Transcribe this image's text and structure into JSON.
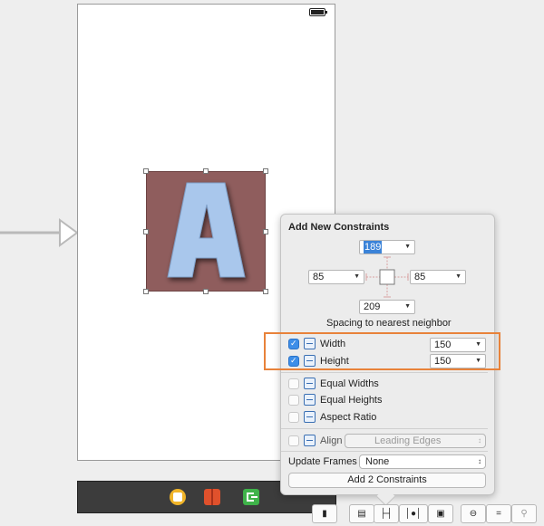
{
  "popover": {
    "title": "Add New Constraints",
    "top_spacing": "189",
    "left_spacing": "85",
    "right_spacing": "85",
    "bottom_spacing": "209",
    "spacing_caption": "Spacing to nearest neighbor",
    "width": {
      "label": "Width",
      "value": "150",
      "checked": true
    },
    "height": {
      "label": "Height",
      "value": "150",
      "checked": true
    },
    "equal_widths_label": "Equal Widths",
    "equal_heights_label": "Equal Heights",
    "aspect_ratio_label": "Aspect Ratio",
    "align_label": "Align",
    "align_value": "Leading Edges",
    "update_frames_label": "Update Frames",
    "update_frames_value": "None",
    "add_button_label": "Add 2 Constraints"
  },
  "canvas": {
    "image_letter": "A",
    "image_background": "#8f5d5d",
    "letter_color": "#a9c7ec"
  },
  "highlight_color": "#e8823a",
  "accent_color": "#3d8ee8",
  "dock_icons": [
    "view-controller-icon",
    "first-responder-icon",
    "exit-icon"
  ],
  "toolbar_icons": [
    "resolve-icon",
    "align-icon",
    "pin-icon",
    "resizing-icon",
    "layout-icon",
    "zoom-out-icon",
    "zoom-reset-icon",
    "zoom-in-icon"
  ]
}
